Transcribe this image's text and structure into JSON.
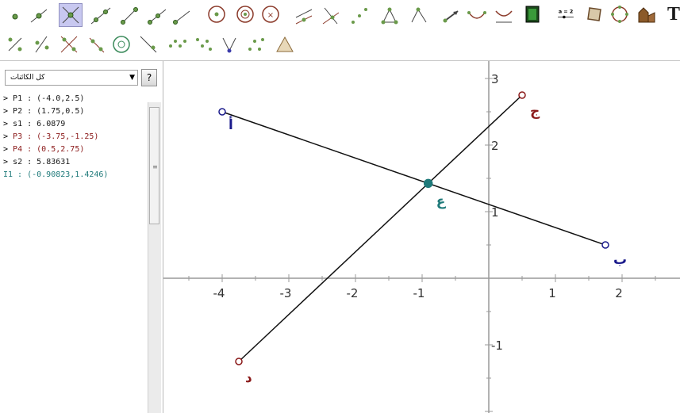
{
  "toolbar": {
    "icons": [
      "move-icon",
      "point-icon",
      "intersect-icon",
      "line-icon",
      "segment-icon",
      "ray-icon",
      "vector-icon",
      "circle-center-point-icon",
      "circle-three-points-icon",
      "circle-radius-icon",
      "parallel-line-icon",
      "perpendicular-line-icon",
      "midpoint-icon",
      "angle-bisector-icon",
      "angle-icon",
      "vector-from-point-icon",
      "arc-icon",
      "sector-icon",
      "animation-icon",
      "slider-icon",
      "polygon-icon",
      "conic-icon",
      "locus-icon",
      "text-icon"
    ],
    "slider_label": "a = 2",
    "text_tool": "T"
  },
  "algebra": {
    "filter": "كل الكائنات",
    "help": "?",
    "prefix": ">",
    "objects": [
      {
        "text": "P1 : (-4.0,2.5)",
        "color": "#1a1a1a",
        "dep": false
      },
      {
        "text": "P2 : (1.75,0.5)",
        "color": "#1a1a1a",
        "dep": false
      },
      {
        "text": "s1 : 6.0879",
        "color": "#1a1a1a",
        "dep": false
      },
      {
        "text": "P3 : (-3.75,-1.25)",
        "color": "#8b1a1a",
        "dep": false
      },
      {
        "text": "P4 : (0.5,2.75)",
        "color": "#8b1a1a",
        "dep": false
      },
      {
        "text": "s2 : 5.83631",
        "color": "#1a1a1a",
        "dep": false
      },
      {
        "text": "I1 : (-0.90823,1.4246)",
        "color": "#1f7a7a",
        "dep": true
      }
    ],
    "scroll_grip": "≡"
  },
  "graphics": {
    "x_ticks": [
      "-4",
      "-3",
      "-2",
      "-1",
      "1",
      "2"
    ],
    "y_ticks": [
      "3",
      "2",
      "1",
      "-1"
    ],
    "points": [
      {
        "id": "P1",
        "label": "أ",
        "x": -4.0,
        "y": 2.5,
        "color": "#1a1a8b"
      },
      {
        "id": "P2",
        "label": "ب",
        "x": 1.75,
        "y": 0.5,
        "color": "#1a1a8b"
      },
      {
        "id": "P3",
        "label": "د",
        "x": -3.75,
        "y": -1.25,
        "color": "#8b1a1a"
      },
      {
        "id": "P4",
        "label": "ج",
        "x": 0.5,
        "y": 2.75,
        "color": "#8b1a1a"
      },
      {
        "id": "I1",
        "label": "ع",
        "x": -0.90823,
        "y": 1.4246,
        "color": "#1f7a7a"
      }
    ],
    "segments": [
      {
        "id": "s1",
        "from": "P1",
        "to": "P2"
      },
      {
        "id": "s2",
        "from": "P3",
        "to": "P4"
      }
    ]
  }
}
